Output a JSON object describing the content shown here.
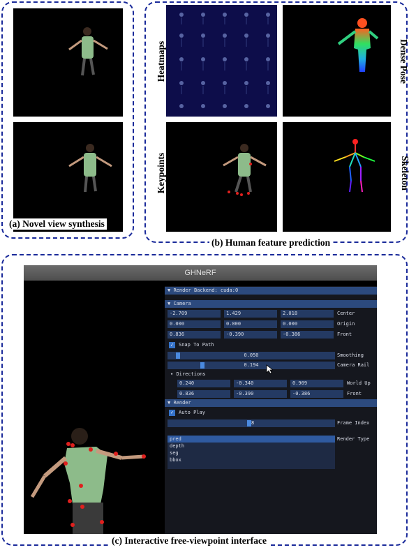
{
  "captions": {
    "a": "(a) Novel view synthesis",
    "b": "(b) Human feature prediction",
    "c": "(c) Interactive free-viewpoint interface"
  },
  "panel_labels": {
    "heatmaps": "Heatmaps",
    "dense_pose": "Dense Pose",
    "keypoints": "Keypoints",
    "skeleton": "Skeleton"
  },
  "gui": {
    "window_title": "GHNeRF",
    "render_backend": "Render Backend: cuda:0",
    "camera_header": "Camera",
    "camera_rows": [
      {
        "values": [
          "-2.709",
          "1.429",
          "2.018"
        ],
        "label": "Center"
      },
      {
        "values": [
          "0.000",
          "0.000",
          "0.000"
        ],
        "label": "Origin"
      },
      {
        "values": [
          "0.836",
          "-0.390",
          "-0.386"
        ],
        "label": "Front"
      }
    ],
    "snap_to_path": "Snap To Path",
    "smoothing": {
      "value": "0.050",
      "label": "Smoothing",
      "level": 0.05
    },
    "camera_rail": {
      "value": "0.194",
      "label": "Camera Rail",
      "level": 0.194
    },
    "directions_header": "Directions",
    "direction_rows": [
      {
        "values": [
          "0.240",
          "-0.340",
          "0.909"
        ],
        "label": "World Up"
      },
      {
        "values": [
          "0.836",
          "-0.390",
          "-0.386"
        ],
        "label": "Front"
      }
    ],
    "render_header": "Render",
    "auto_play": "Auto Play",
    "frame_index": {
      "value": "28",
      "label": "Frame Index",
      "level": 0.5
    },
    "render_types": [
      "pred",
      "depth",
      "seg",
      "bbox"
    ],
    "render_type_label": "Render Type",
    "selected_render_type": "pred"
  }
}
